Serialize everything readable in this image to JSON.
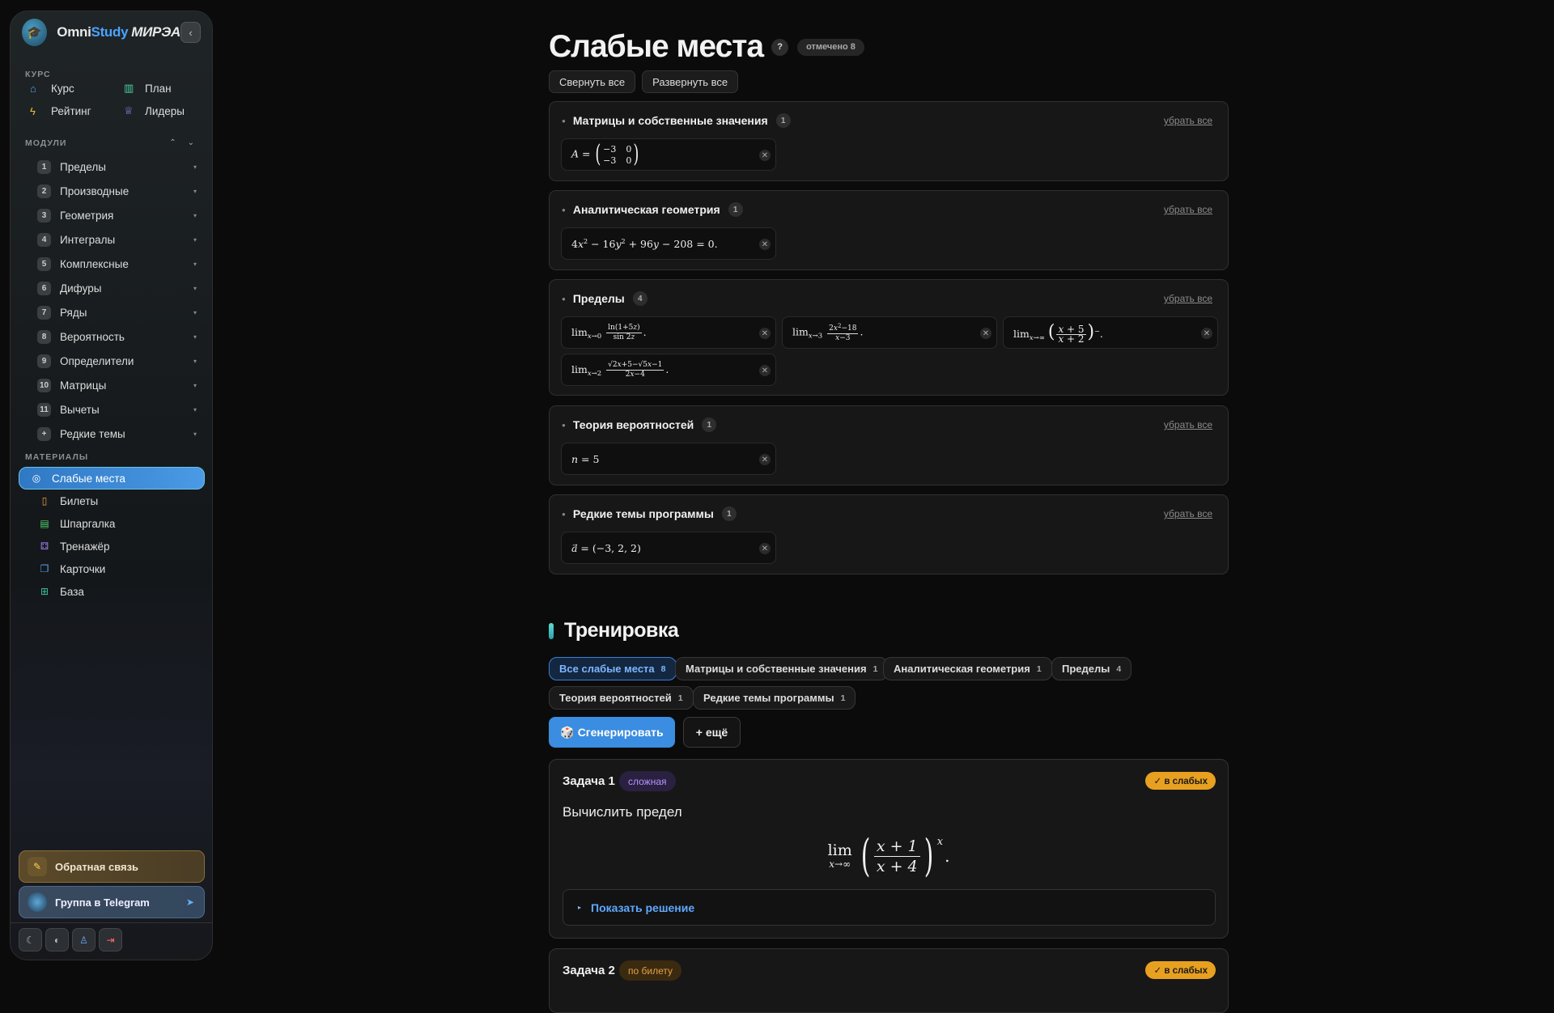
{
  "app": {
    "brand_omni": "Omni",
    "brand_study": "Study",
    "brand_mirea": "МИРЭА"
  },
  "sidebar": {
    "course_title": "КУРС",
    "course_items": [
      {
        "label": "Курс",
        "icon": "home-icon",
        "color": "#5aa0f0"
      },
      {
        "label": "План",
        "icon": "map-icon",
        "color": "#4ad0a0"
      },
      {
        "label": "Рейтинг",
        "icon": "bolt-icon",
        "color": "#f0c040"
      },
      {
        "label": "Лидеры",
        "icon": "trophy-icon",
        "color": "#8a8af0"
      }
    ],
    "modules_title": "МОДУЛИ",
    "modules": [
      {
        "num": "1",
        "label": "Пределы"
      },
      {
        "num": "2",
        "label": "Производные"
      },
      {
        "num": "3",
        "label": "Геометрия"
      },
      {
        "num": "4",
        "label": "Интегралы"
      },
      {
        "num": "5",
        "label": "Комплексные"
      },
      {
        "num": "6",
        "label": "Дифуры"
      },
      {
        "num": "7",
        "label": "Ряды"
      },
      {
        "num": "8",
        "label": "Вероятность"
      },
      {
        "num": "9",
        "label": "Определители"
      },
      {
        "num": "10",
        "label": "Матрицы"
      },
      {
        "num": "11",
        "label": "Вычеты"
      },
      {
        "num": "+",
        "label": "Редкие темы"
      }
    ],
    "materials_title": "МАТЕРИАЛЫ",
    "materials": [
      {
        "label": "Слабые места",
        "icon": "target-icon",
        "active": true
      },
      {
        "label": "Билеты",
        "icon": "book-icon"
      },
      {
        "label": "Шпаргалка",
        "icon": "notes-icon"
      },
      {
        "label": "Тренажёр",
        "icon": "dice-icon"
      },
      {
        "label": "Карточки",
        "icon": "cards-icon"
      },
      {
        "label": "База",
        "icon": "database-icon"
      }
    ],
    "feedback_label": "Обратная связь",
    "telegram_label": "Группа в Telegram"
  },
  "page": {
    "title": "Слабые места",
    "help": "?",
    "marked": "отмечено 8",
    "collapse_all": "Свернуть все",
    "expand_all": "Развернуть все",
    "remove_all": "убрать все"
  },
  "groups": [
    {
      "title": "Матрицы и собственные значения",
      "count": "1"
    },
    {
      "title": "Аналитическая геометрия",
      "count": "1"
    },
    {
      "title": "Пределы",
      "count": "4"
    },
    {
      "title": "Теория вероятностей",
      "count": "1"
    },
    {
      "title": "Редкие темы программы",
      "count": "1"
    }
  ],
  "training": {
    "title": "Тренировка",
    "tags": [
      {
        "label": "Все слабые места",
        "n": "8"
      },
      {
        "label": "Матрицы и собственные значения",
        "n": "1"
      },
      {
        "label": "Аналитическая геометрия",
        "n": "1"
      },
      {
        "label": "Пределы",
        "n": "4"
      },
      {
        "label": "Теория вероятностей",
        "n": "1"
      },
      {
        "label": "Редкие темы программы",
        "n": "1"
      }
    ],
    "generate": "🎲 Сгенерировать",
    "more": "+ ещё"
  },
  "tasks": [
    {
      "title": "Задача 1",
      "difficulty": "сложная",
      "badge": "✓ в слабых",
      "question": "Вычислить предел",
      "show_solution": "Показать решение"
    },
    {
      "title": "Задача 2",
      "difficulty": "по билету",
      "badge": "✓ в слабых"
    }
  ]
}
